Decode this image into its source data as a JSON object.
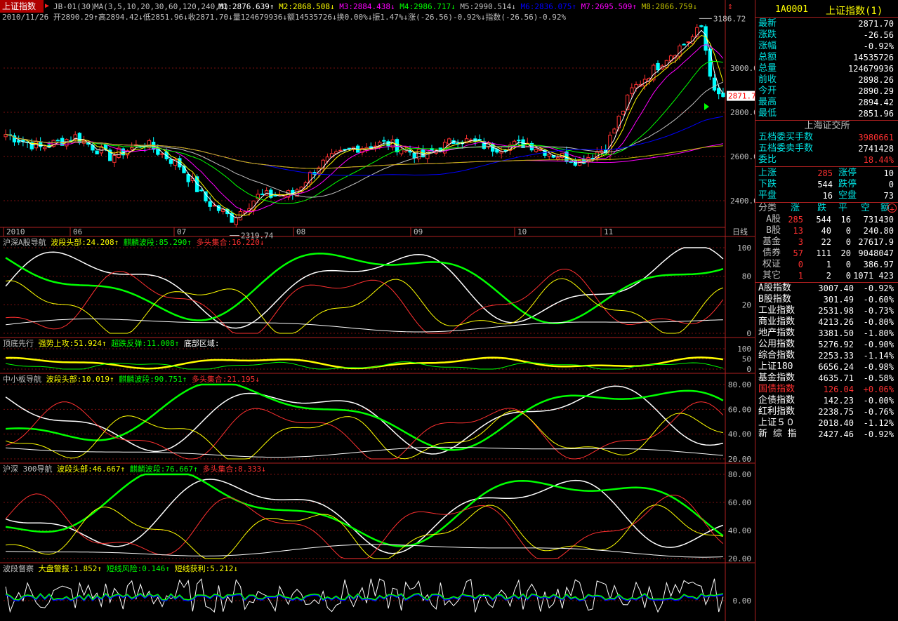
{
  "title": "上证指数",
  "formula": "JB-01(30)",
  "ma_params": "MA(3,5,10,20,30,60,120,240,8)",
  "ma_values": [
    {
      "label": "M1:2876.639↑",
      "color": "#ffffff"
    },
    {
      "label": "M2:2868.508↓",
      "color": "#ffff00"
    },
    {
      "label": "M3:2884.438↓",
      "color": "#ff00ff"
    },
    {
      "label": "M4:2986.717↓",
      "color": "#00ff00"
    },
    {
      "label": "M5:2990.514↓",
      "color": "#c0c0c0"
    },
    {
      "label": "M6:2836.075↑",
      "color": "#0000ff"
    },
    {
      "label": "M7:2695.509↑",
      "color": "#ff00ff"
    },
    {
      "label": "M8:2866.759↓",
      "color": "#c0c000"
    }
  ],
  "bar_info": "2010/11/26 开2890.29↑高2894.42↓低2851.96↓收2871.70↓量124679936↓额14535726↓换0.00%↓振1.47%↓涨(-26.56)-0.92%↓指数(-26.56)-0.92%",
  "price_axis": [
    "3000.0",
    "2800.0",
    "2600.0",
    "2400.0"
  ],
  "price_tag": "2871.7",
  "annotations": {
    "high": "3186.72",
    "low": "2319.74"
  },
  "x_labels": [
    "2010",
    "06",
    "07",
    "08",
    "09",
    "10",
    "11"
  ],
  "period_label": "日线",
  "indicators": [
    {
      "name": "沪深A股导航",
      "items": [
        {
          "t": "波段头部:24.208↑",
          "c": "#ffff00"
        },
        {
          "t": "麒麟波段:85.290↑",
          "c": "#00ff00"
        },
        {
          "t": "多头集合:16.220↓",
          "c": "#ff3030"
        }
      ],
      "axis": [
        "100",
        "80",
        "20",
        "0"
      ]
    },
    {
      "name": "顶底先行",
      "items": [
        {
          "t": "强势上攻:51.924↑",
          "c": "#ffff00"
        },
        {
          "t": "超跌反弹:11.008↑",
          "c": "#00ff00"
        },
        {
          "t": "底部区域:",
          "c": "#ffffff"
        }
      ],
      "axis": [
        "100",
        "50",
        "0"
      ]
    },
    {
      "name": "中小板导航",
      "items": [
        {
          "t": "波段头部:10.019↑",
          "c": "#ffff00"
        },
        {
          "t": "麒麟波段:90.751↑",
          "c": "#00ff00"
        },
        {
          "t": "多头集合:21.195↓",
          "c": "#ff3030"
        }
      ],
      "axis": [
        "80.00",
        "60.00",
        "40.00",
        "20.00"
      ]
    },
    {
      "name": "沪深 300导航",
      "items": [
        {
          "t": "波段头部:46.667↑",
          "c": "#ffff00"
        },
        {
          "t": "麒麟波段:76.667↑",
          "c": "#00ff00"
        },
        {
          "t": "多头集合:8.333↓",
          "c": "#ff3030"
        }
      ],
      "axis": [
        "80.00",
        "60.00",
        "40.00",
        "20.00"
      ]
    },
    {
      "name": "波段督察",
      "items": [
        {
          "t": "大盘警报:1.852↑",
          "c": "#ffff00"
        },
        {
          "t": "短线风险:0.146↑",
          "c": "#00ff00"
        },
        {
          "t": "短线获利:5.212↓",
          "c": "#ffff00"
        }
      ],
      "axis": [
        "0.00"
      ]
    }
  ],
  "side": {
    "code": "1A0001",
    "name": "上证指数(1)",
    "quote": [
      {
        "l": "最新",
        "v": "2871.70"
      },
      {
        "l": "涨跌",
        "v": "-26.56"
      },
      {
        "l": "涨幅",
        "v": "-0.92%"
      },
      {
        "l": "总额",
        "v": "14535726"
      },
      {
        "l": "总量",
        "v": "124679936"
      },
      {
        "l": "前收",
        "v": "2898.26"
      },
      {
        "l": "今开",
        "v": "2890.29"
      },
      {
        "l": "最高",
        "v": "2894.42"
      },
      {
        "l": "最低",
        "v": "2851.96"
      }
    ],
    "exchange": "上海证交所",
    "order": [
      {
        "l": "五档委买手数",
        "v": "3980661",
        "c": "#ff3030"
      },
      {
        "l": "五档委卖手数",
        "v": "2741428",
        "c": "#ffffff"
      },
      {
        "l": "委比",
        "v": "18.44%",
        "c": "#ff3030"
      }
    ],
    "breadth": [
      {
        "l1": "上涨",
        "v1": "285",
        "l2": "涨停",
        "v2": "10",
        "c": "#ff3030"
      },
      {
        "l1": "下跌",
        "v1": "544",
        "l2": "跌停",
        "v2": "0",
        "c": "#ffffff"
      },
      {
        "l1": "平盘",
        "v1": "16",
        "l2": "空盘",
        "v2": "73",
        "c": "#ffffff"
      }
    ],
    "table_header": [
      "分类",
      "涨",
      "跌",
      "平",
      "空",
      "额"
    ],
    "table": [
      [
        "A股",
        "285",
        "544",
        "16",
        "731430"
      ],
      [
        "B股",
        "13",
        "40",
        "0",
        "240.80"
      ],
      [
        "基金",
        "3",
        "22",
        "0",
        "27617.9"
      ],
      [
        "债券",
        "57",
        "111",
        "20",
        "9048047"
      ],
      [
        "权证",
        "0",
        "1",
        "0",
        "386.97"
      ],
      [
        "其它",
        "1",
        "2",
        "0",
        "1071 423"
      ]
    ],
    "indices": [
      {
        "n": "A股指数",
        "v": "3007.40",
        "p": "-0.92%"
      },
      {
        "n": "B股指数",
        "v": "301.49",
        "p": "-0.60%"
      },
      {
        "n": "工业指数",
        "v": "2531.98",
        "p": "-0.73%"
      },
      {
        "n": "商业指数",
        "v": "4213.26",
        "p": "-0.80%"
      },
      {
        "n": "地产指数",
        "v": "3381.50",
        "p": "-1.80%"
      },
      {
        "n": "公用指数",
        "v": "5276.92",
        "p": "-0.90%"
      },
      {
        "n": "综合指数",
        "v": "2253.33",
        "p": "-1.14%"
      },
      {
        "n": "上证180",
        "v": "6656.24",
        "p": "-0.98%"
      },
      {
        "n": "基金指数",
        "v": "4635.71",
        "p": "-0.58%"
      },
      {
        "n": "国债指数",
        "v": "126.04",
        "p": "+0.06%",
        "red": true
      },
      {
        "n": "企债指数",
        "v": "142.23",
        "p": "-0.00%"
      },
      {
        "n": "红利指数",
        "v": "2238.75",
        "p": "-0.76%"
      },
      {
        "n": "上证５０",
        "v": "2018.40",
        "p": "-1.12%"
      },
      {
        "n": "新 综 指",
        "v": "2427.46",
        "p": "-0.92%"
      }
    ]
  }
}
